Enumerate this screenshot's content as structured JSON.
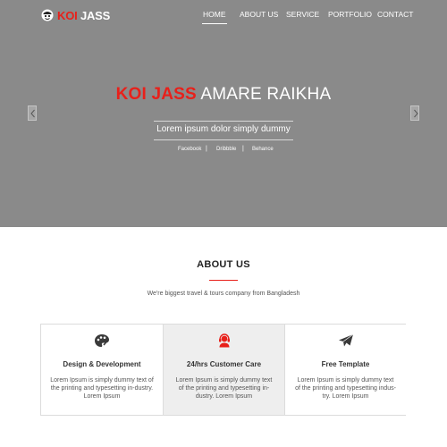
{
  "brand": {
    "name_red": "KOI",
    "name_white": "JASS"
  },
  "nav": {
    "items": [
      "HOME",
      "ABOUT US",
      "SERVICE",
      "PORTFOLIO",
      "CONTACT"
    ],
    "active": "HOME"
  },
  "hero": {
    "headline_red": "KOI JASS",
    "headline_white": "AMARE RAIKHA",
    "subline": "Lorem ipsum dolor simply dummy",
    "social": [
      "Facebook",
      "Dribbble",
      "Behance"
    ],
    "separator": "|",
    "prev_icon": "chevron-left-icon",
    "next_icon": "chevron-right-icon"
  },
  "about": {
    "title": "ABOUT US",
    "text": "We're biggest travel & tours company from Bangladesh",
    "cards": [
      {
        "icon": "palette-icon",
        "title": "Design & Development",
        "text": "Lorem Ipsum is simply dummy text of the printing and typesetting in-dustry. Lorem Ipsum"
      },
      {
        "icon": "headset-icon",
        "title": "24/hrs Customer Care",
        "text": "Lorem Ipsum is simply dummy text of the printing and typesetting in-dustry. Lorem Ipsum"
      },
      {
        "icon": "paper-plane-icon",
        "title": "Free Template",
        "text": "Lorem Ipsum is simply dummy text of the printing and typesetting indus-try. Lorem Ipsum"
      }
    ]
  },
  "colors": {
    "accent": "#e8201a",
    "hero_bg": "#8a8a8a",
    "card_highlight": "#eeeeee"
  }
}
